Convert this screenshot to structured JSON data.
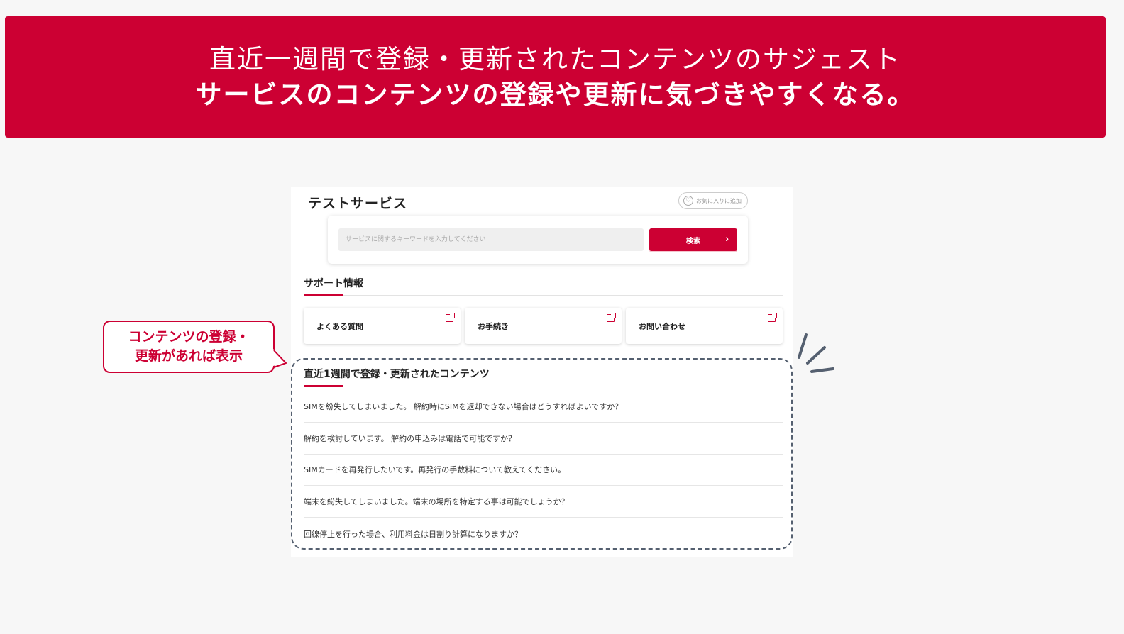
{
  "banner": {
    "line1": "直近一週間で登録・更新されたコンテンツのサジェスト",
    "line2": "サービスのコンテンツの登録や更新に気づきやすくなる。"
  },
  "service": {
    "title": "テストサービス",
    "favorite_label": "お気に入りに追加",
    "search_placeholder": "サービスに関するキーワードを入力してください",
    "search_button": "検索"
  },
  "support": {
    "title": "サポート情報",
    "cards": [
      "よくある質問",
      "お手続き",
      "お問い合わせ"
    ]
  },
  "recent": {
    "title": "直近1週間で登録・更新されたコンテンツ",
    "items": [
      "SIMを紛失してしまいました。 解約時にSIMを返却できない場合はどうすればよいですか？",
      "解約を検討しています。 解約の申込みは電話で可能ですか？",
      "SIMカードを再発行したいです。再発行の手数料について教えてください。",
      "端末を紛失してしまいました。端末の場所を特定する事は可能でしょうか？",
      "回線停止を行った場合、利用料金は日割り計算になりますか？"
    ]
  },
  "callout": {
    "line1": "コンテンツの登録・",
    "line2": "更新があれば表示"
  },
  "colors": {
    "accent": "#cc0033",
    "dashed_border": "#556070"
  }
}
